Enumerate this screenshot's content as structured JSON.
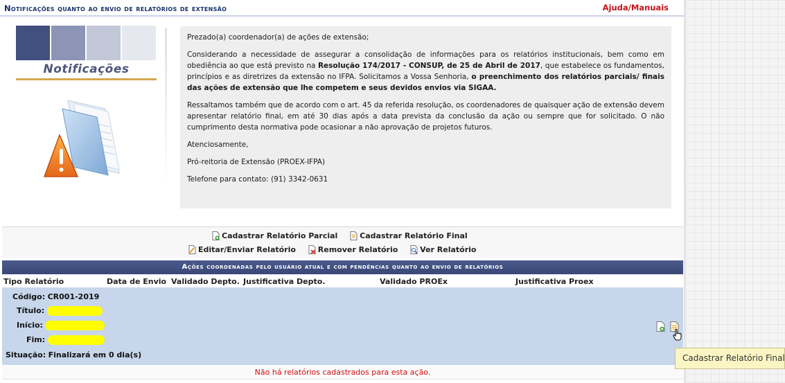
{
  "header": {
    "title": "Notificações quanto ao envio de relatórios de extensão",
    "help": "Ajuda/Manuais"
  },
  "logo": {
    "text": "Notificações",
    "square_colors": [
      "#41507f",
      "#8c95b5",
      "#c2c8d8",
      "#e6e8f0"
    ],
    "accent": "#d4a64e"
  },
  "illustration": {
    "icon": "warning-folder-icon"
  },
  "notice": {
    "greeting": "Prezado(a) coordenador(a) de ações de extensão;",
    "p1_a": "Considerando a necessidade de assegurar a consolidação de informações para os relatórios institucionais, bem como em obediência ao que está previsto na ",
    "p1_b": "Resolução 174/2017 - CONSUP, de 25 de Abril de 2017",
    "p1_c": ", que estabelece os fundamentos, princípios e as diretrizes da extensão no IFPA. Solicitamos a Vossa Senhoria, ",
    "p1_d": "o preenchimento dos relatórios parciais/ finais das ações de extensão que lhe competem e seus devidos envios via SIGAA.",
    "p2": "Ressaltamos também que de acordo com o art. 45 da referida resolução, os coordenadores de quaisquer ação de extensão devem apresentar relatório final, em até 30 dias após a data prevista da conclusão da ação ou sempre que for solicitado. O não cumprimento desta normativa pode ocasionar a não aprovação de projetos futuros.",
    "closing": "Atenciosamente,",
    "signature": "Pró-reitoria de Extensão (PROEX-IFPA)",
    "phone": "Telefone para contato: (91) 3342-0631"
  },
  "legend": {
    "parcial": "Cadastrar Relatório Parcial",
    "final": "Cadastrar Relatório Final",
    "editar": "Editar/Enviar Relatório",
    "remover": "Remover Relatório",
    "ver": "Ver Relatório"
  },
  "table": {
    "caption": "Ações coordenadas pelo usuário atual e com pendências quanto ao envio de relatórios",
    "columns": [
      "Tipo Relatório",
      "Data de Envio",
      "Validado Depto.",
      "Justificativa Depto.",
      "Validado PROEx",
      "Justificativa Proex"
    ],
    "row": {
      "codigo_label": "Código:",
      "codigo_value": "CR001-2019",
      "titulo_label": "Título:",
      "inicio_label": "Início:",
      "fim_label": "Fim:",
      "situacao_label": "Situação:",
      "situacao_value": "Finalizará em 0 dia(s)"
    },
    "empty_message": "Não há relatórios cadastrados para esta ação."
  },
  "tooltip": "Cadastrar Relatório Final",
  "colors": {
    "header_text": "#18306b",
    "help_link": "#c4141b",
    "caption_bg": "#3f4c7c",
    "row_bg": "#c7d6ea",
    "empty_text": "#d10f0f"
  }
}
